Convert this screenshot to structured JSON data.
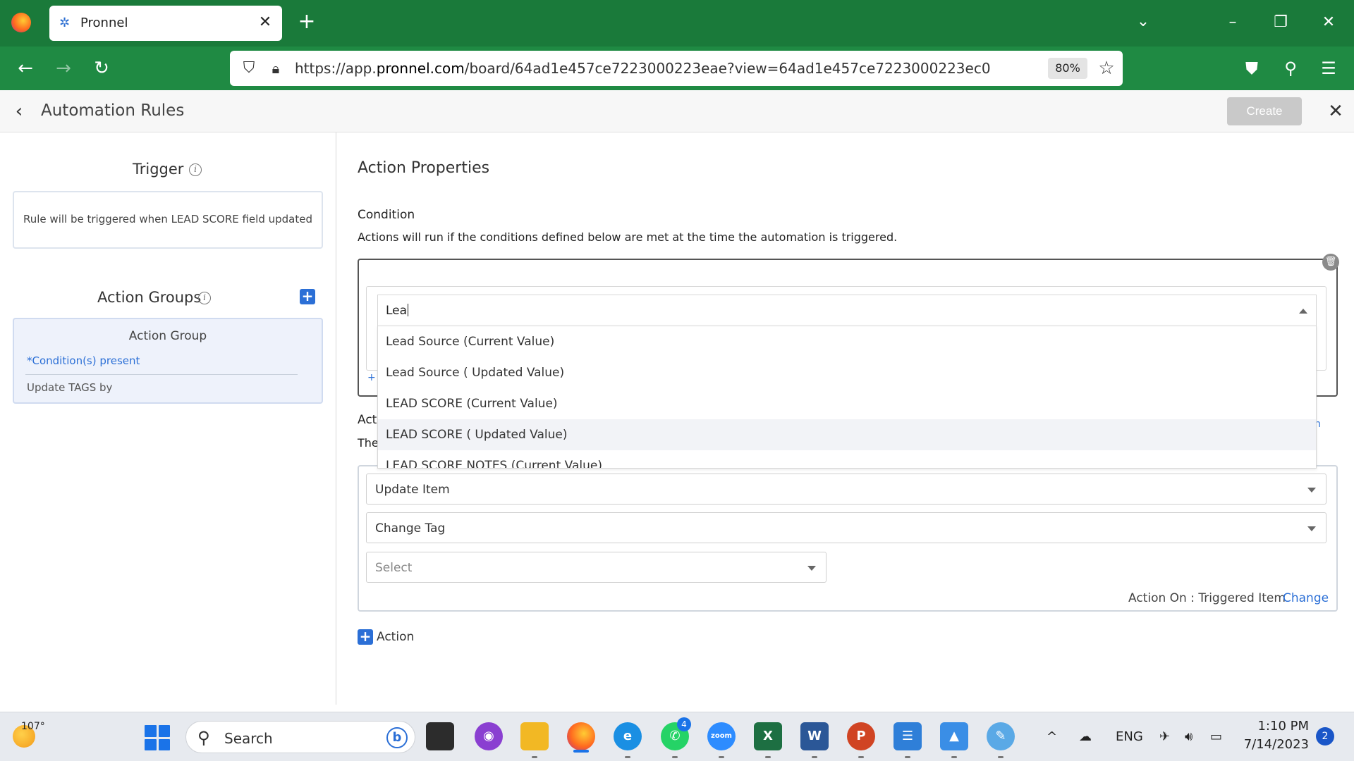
{
  "browser": {
    "tab_title": "Pronnel",
    "url_prefix": "https://app.",
    "url_domain": "pronnel.com",
    "url_path": "/board/64ad1e457ce7223000223eae?view=64ad1e457ce7223000223ec0",
    "zoom": "80%"
  },
  "header": {
    "title": "Automation Rules",
    "create_label": "Create"
  },
  "left": {
    "trigger_title": "Trigger",
    "trigger_text": "Rule will be triggered when LEAD SCORE field updated",
    "action_groups_title": "Action Groups",
    "group": {
      "title": "Action Group",
      "condition": "*Condition(s) present",
      "update": "Update TAGS by"
    }
  },
  "right": {
    "title": "Action Properties",
    "condition_label": "Condition",
    "condition_desc": "Actions will run if the conditions defined below are met at the time the automation is triggered.",
    "condition_add": "+",
    "action_label_partial": "Act",
    "action_desc_partial": "The",
    "action_link_partial": "n",
    "selects": {
      "update_item": "Update Item",
      "change_tag": "Change Tag",
      "select_placeholder": "Select"
    },
    "action_on": "Action On : Triggered Item",
    "change_link": "Change",
    "add_action": "Action"
  },
  "dropdown": {
    "query": "Lea",
    "options": [
      "Lead Source (Current Value)",
      "Lead Source ( Updated Value)",
      "LEAD SCORE (Current Value)",
      "LEAD SCORE ( Updated Value)",
      "LEAD SCORE NOTES (Current Value)"
    ],
    "highlighted_index": 3
  },
  "taskbar": {
    "weather": "107°",
    "search": "Search",
    "whatsapp_badge": "4",
    "lang": "ENG",
    "time": "1:10 PM",
    "date": "7/14/2023",
    "notifications": "2"
  }
}
